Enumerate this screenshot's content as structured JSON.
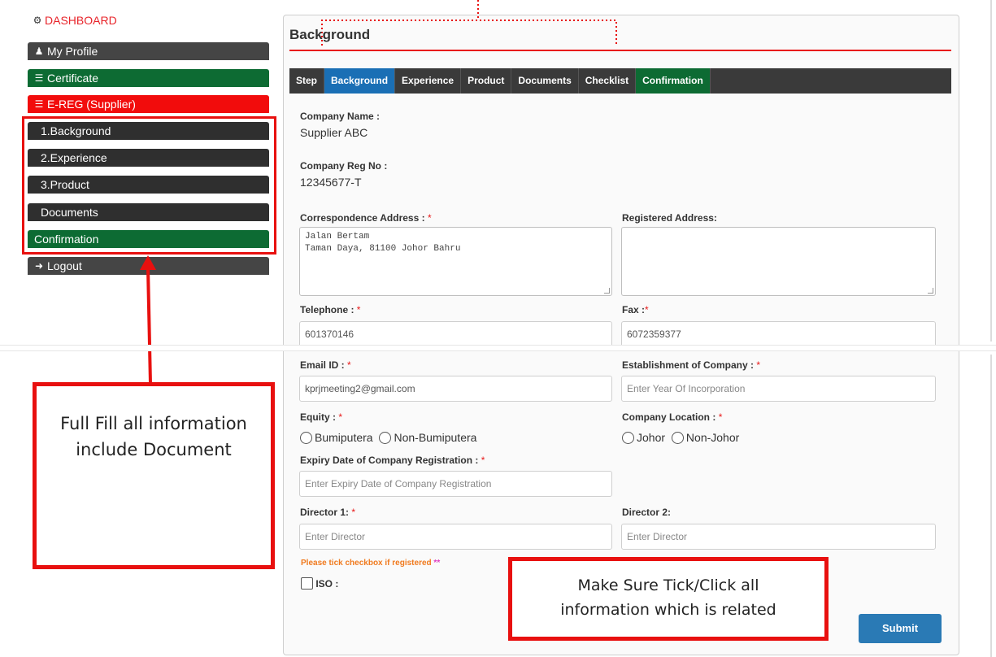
{
  "sidebar": {
    "dashboard": "DASHBOARD",
    "items": [
      {
        "label": "My Profile",
        "icon": "user-icon"
      },
      {
        "label": "Certificate",
        "icon": "list-icon"
      },
      {
        "label": "E-REG (Supplier)",
        "icon": "list-icon"
      },
      {
        "label": "1.Background"
      },
      {
        "label": "2.Experience"
      },
      {
        "label": "3.Product"
      },
      {
        "label": "Documents"
      },
      {
        "label": "Confirmation"
      },
      {
        "label": "Logout",
        "icon": "sign-out-icon"
      }
    ]
  },
  "main": {
    "title": "Background",
    "tabs": [
      "Step",
      "Background",
      "Experience",
      "Product",
      "Documents",
      "Checklist",
      "Confirmation"
    ],
    "company_name_label": "Company Name :",
    "company_name": "Supplier ABC",
    "company_reg_label": "Company Reg No :",
    "company_reg": "12345677-T",
    "corr_address_label": "Correspondence Address :",
    "corr_address": "Jalan Bertam\nTaman Daya, 81100 Johor Bahru",
    "reg_address_label": "Registered Address:",
    "telephone_label": "Telephone :",
    "telephone": "601370146",
    "fax_label": "Fax :",
    "fax": "6072359377",
    "email_label": "Email ID :",
    "email": "kprjmeeting2@gmail.com",
    "establish_label": "Establishment of Company :",
    "establish_placeholder": "Enter Year Of Incorporation",
    "equity_label": "Equity :",
    "equity_options": [
      "Bumiputera",
      "Non-Bumiputera"
    ],
    "location_label": "Company Location :",
    "location_options": [
      "Johor",
      "Non-Johor"
    ],
    "expiry_label": "Expiry Date of Company Registration :",
    "expiry_placeholder": "Enter Expiry Date of Company Registration",
    "director1_label": "Director 1:",
    "director1_placeholder": "Enter Director",
    "director2_label": "Director 2:",
    "director2_placeholder": "Enter Director",
    "tick_note": "Please tick checkbox if registered",
    "tick_stars": "**",
    "iso_label": "ISO :",
    "submit": "Submit",
    "required_mark": "*"
  },
  "annotations": {
    "left_box": "Full Fill all information include Document",
    "bottom_box": "Make Sure Tick/Click all information which is related"
  },
  "colors": {
    "accent_red": "#e8100f",
    "tab_active": "#1a6fb5",
    "green": "#0d6b33",
    "submit": "#2a7ab5"
  }
}
